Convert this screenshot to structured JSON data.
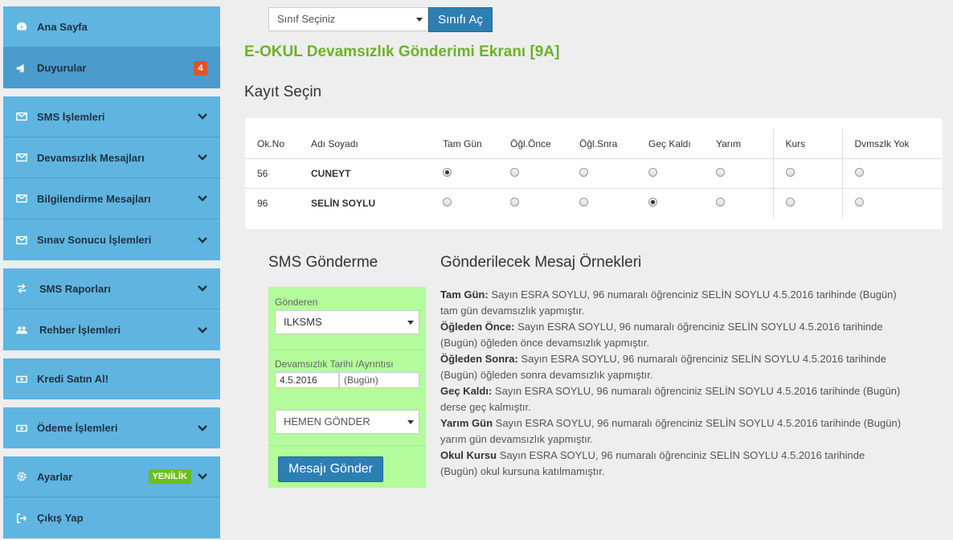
{
  "sidebar": {
    "groups": [
      [
        {
          "label": "Ana Sayfa",
          "icon": "dashboard-icon",
          "active": false
        },
        {
          "label": "Duyurular",
          "icon": "megaphone-icon",
          "active": true,
          "badge": "4"
        }
      ],
      [
        {
          "label": "SMS İşlemleri",
          "icon": "envelope-icon",
          "chevron": true
        },
        {
          "label": "Devamsızlık Mesajları",
          "icon": "envelope-icon",
          "chevron": true
        },
        {
          "label": "Bilgilendirme Mesajları",
          "icon": "envelope-icon",
          "chevron": true
        },
        {
          "label": "Sınav Sonucu İşlemleri",
          "icon": "envelope-icon",
          "chevron": true
        }
      ],
      [
        {
          "label": "SMS Raporları",
          "icon": "exchange-icon",
          "chevron": true
        },
        {
          "label": "Rehber İşlemleri",
          "icon": "users-icon",
          "chevron": true
        }
      ],
      [
        {
          "label": "Kredi Satın Al!",
          "icon": "money-icon"
        }
      ],
      [
        {
          "label": "Ödeme İşlemleri",
          "icon": "money-icon",
          "chevron": true
        }
      ],
      [
        {
          "label": "Ayarlar",
          "icon": "gear-icon",
          "chevron": true,
          "tag": "YENİLİK"
        },
        {
          "label": "Çıkış Yap",
          "icon": "sign-out-icon"
        }
      ]
    ]
  },
  "topbar": {
    "class_select_value": "Sınıf Seçiniz",
    "open_button": "Sınıfı Aç"
  },
  "page_title": "E-OKUL Devamsızlık Gönderimi Ekranı [9A]",
  "records_title": "Kayıt Seçin",
  "table": {
    "headers": [
      "Ok.No",
      "Adı Soyadı",
      "Tam Gün",
      "Öğl.Önce",
      "Öğl.Snra",
      "Geç Kaldı",
      "Yarım",
      "Kurs",
      "Dvmszlk Yok"
    ],
    "rows": [
      {
        "no": "56",
        "name": "CUNEYT",
        "selected": 0
      },
      {
        "no": "96",
        "name": "SELİN SOYLU",
        "selected": 3
      }
    ]
  },
  "sms": {
    "title": "SMS Gönderme",
    "sender_label": "Gönderen",
    "sender_value": "ILKSMS",
    "date_label": "Devamsızlık Tarihi /Ayrıntısı",
    "date_value": "4.5.2016",
    "date_detail": "(Bugün)",
    "timing_value": "HEMEN GÖNDER",
    "send_button": "Mesajı Gönder"
  },
  "messages": {
    "title": "Gönderilecek Mesaj Örnekleri",
    "items": [
      {
        "label": "Tam Gün:",
        "text": "Sayın ESRA SOYLU, 96 numaralı öğrenciniz SELİN SOYLU 4.5.2016 tarihinde (Bugün) tam gün devamsızlık yapmıştır."
      },
      {
        "label": "Öğleden Önce:",
        "text": "Sayın ESRA SOYLU, 96 numaralı öğrenciniz SELİN SOYLU 4.5.2016 tarihinde (Bugün) öğleden önce devamsızlık yapmıştır."
      },
      {
        "label": "Öğleden Sonra:",
        "text": "Sayın ESRA SOYLU, 96 numaralı öğrenciniz SELİN SOYLU 4.5.2016 tarihinde (Bugün) öğleden sonra devamsızlık yapmıştır."
      },
      {
        "label": "Geç Kaldı:",
        "text": "Sayın ESRA SOYLU, 96 numaralı öğrenciniz SELİN SOYLU 4.5.2016 tarihinde (Bugün) derse geç kalmıştır."
      },
      {
        "label": "Yarım Gün",
        "text": "Sayın ESRA SOYLU, 96 numaralı öğrenciniz SELİN SOYLU 4.5.2016 tarihinde (Bugün) yarım gün devamsızlık yapmıştır."
      },
      {
        "label": "Okul Kursu",
        "text": "Sayın ESRA SOYLU, 96 numaralı öğrenciniz SELİN SOYLU 4.5.2016 tarihinde (Bugün) okul kursuna katılmamıştır."
      }
    ]
  },
  "colors": {
    "title_green": "#6cb22a",
    "sidebar_blue": "#5fb5e0",
    "sms_box_green": "#b3fb9b",
    "button_blue": "#2d7fb2"
  }
}
